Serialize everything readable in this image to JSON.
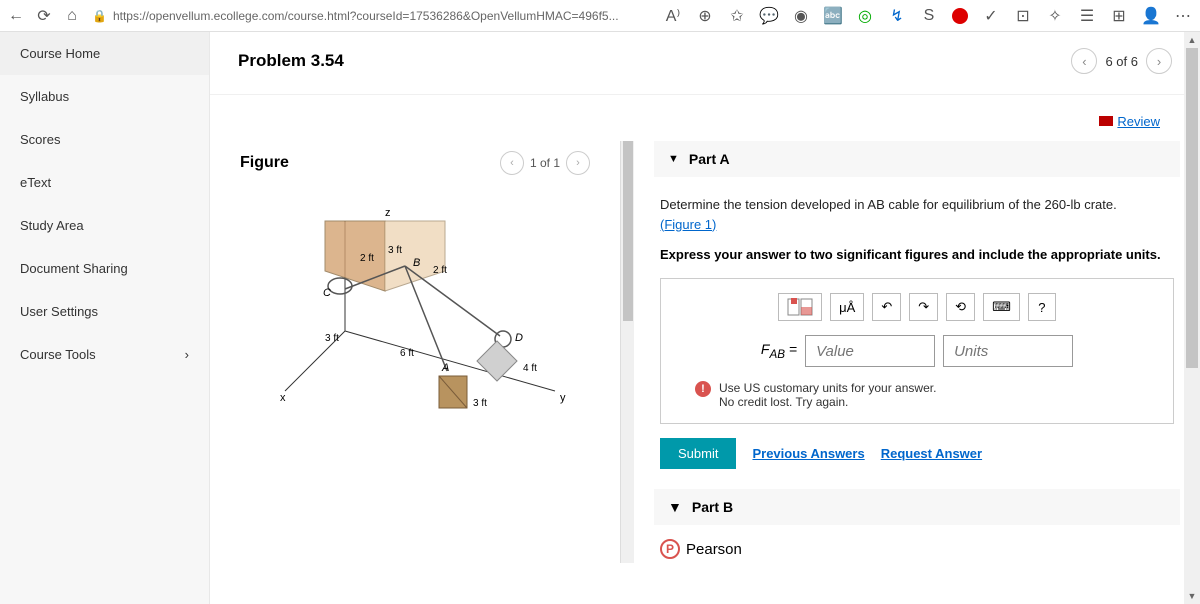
{
  "browser": {
    "url": "https://openvellum.ecollege.com/course.html?courseId=17536286&OpenVellumHMAC=496f5..."
  },
  "sidebar": {
    "items": [
      {
        "label": "Course Home"
      },
      {
        "label": "Syllabus"
      },
      {
        "label": "Scores"
      },
      {
        "label": "eText"
      },
      {
        "label": "Study Area"
      },
      {
        "label": "Document Sharing"
      },
      {
        "label": "User Settings"
      },
      {
        "label": "Course Tools"
      }
    ]
  },
  "problem": {
    "title": "Problem 3.54",
    "pager": "6 of 6",
    "review": "Review"
  },
  "figure": {
    "title": "Figure",
    "pager": "1 of 1",
    "labels": {
      "z": "z",
      "x": "x",
      "y": "y",
      "A": "A",
      "B": "B",
      "C": "C",
      "D": "D",
      "d2a": "2 ft",
      "d3a": "3 ft",
      "d2b": "2 ft",
      "d3b": "3 ft",
      "d6": "6 ft",
      "d4": "4 ft",
      "d3c": "3 ft"
    }
  },
  "partA": {
    "title": "Part A",
    "q1": "Determine the tension developed in AB cable for equilibrium of the 260-lb crate.",
    "figlink": "(Figure 1)",
    "q2": "Express your answer to two significant figures and include the appropriate units.",
    "mu": "μÅ",
    "help": "?",
    "var": "F",
    "sub": "AB",
    "eq": "=",
    "val_ph": "Value",
    "unit_ph": "Units",
    "hint1": "Use US customary units for your answer.",
    "hint2": "No credit lost. Try again.",
    "submit": "Submit",
    "prev": "Previous Answers",
    "req": "Request Answer"
  },
  "partB": {
    "title": "Part B"
  },
  "pearson": "Pearson"
}
